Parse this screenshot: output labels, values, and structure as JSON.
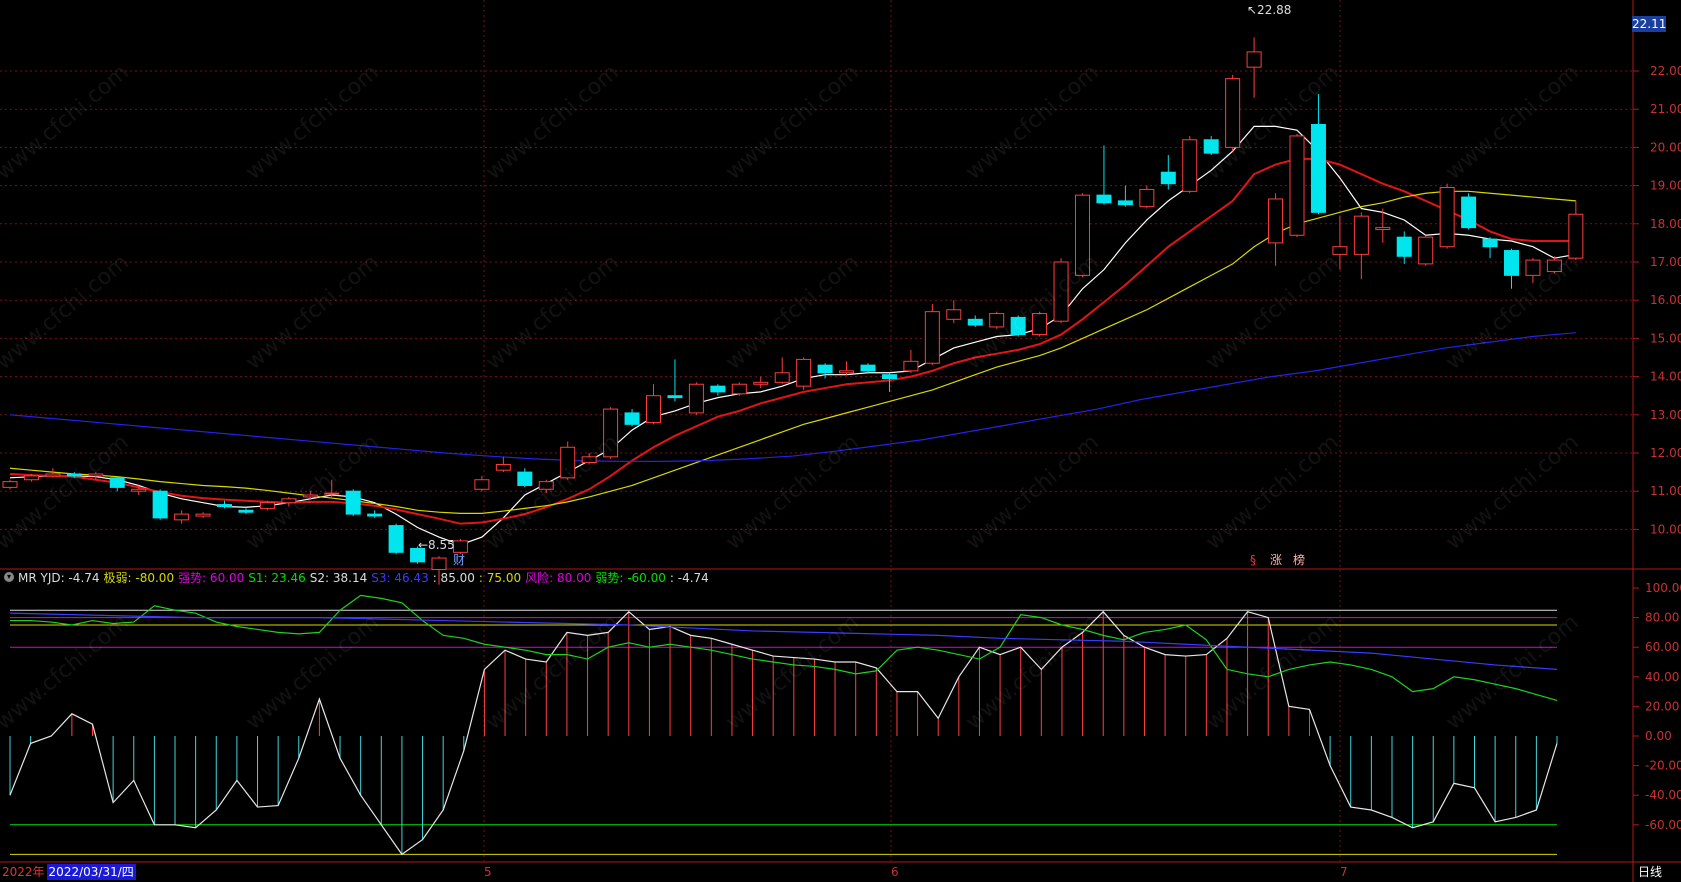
{
  "chart_data": [
    {
      "type": "candlestick",
      "title": "",
      "ylim": [
        9.0,
        22.9
      ],
      "y_ticks": [
        "22.00",
        "21.00",
        "20.00",
        "19.00",
        "18.00",
        "17.00",
        "16.00",
        "15.00",
        "14.00",
        "13.00",
        "12.00",
        "11.00",
        "10.00"
      ],
      "current_price": "22.11",
      "annotations": {
        "high": "22.88",
        "low": "8.55",
        "event_marker_1": "财",
        "event_marker_2": "§",
        "event_marker_3": "涨",
        "event_marker_4": "榜"
      },
      "x_month_labels": [
        "5",
        "6",
        "7"
      ],
      "candles": [
        {
          "o": 11.1,
          "c": 11.25,
          "h": 11.3,
          "l": 11.05
        },
        {
          "o": 11.3,
          "c": 11.4,
          "h": 11.45,
          "l": 11.25
        },
        {
          "o": 11.4,
          "c": 11.45,
          "h": 11.6,
          "l": 11.35
        },
        {
          "o": 11.45,
          "c": 11.4,
          "h": 11.5,
          "l": 11.35
        },
        {
          "o": 11.4,
          "c": 11.45,
          "h": 11.5,
          "l": 11.3
        },
        {
          "o": 11.35,
          "c": 11.1,
          "h": 11.4,
          "l": 11.0
        },
        {
          "o": 11.0,
          "c": 11.05,
          "h": 11.15,
          "l": 10.9
        },
        {
          "o": 11.0,
          "c": 10.3,
          "h": 11.05,
          "l": 10.25
        },
        {
          "o": 10.25,
          "c": 10.4,
          "h": 10.5,
          "l": 10.15
        },
        {
          "o": 10.35,
          "c": 10.4,
          "h": 10.45,
          "l": 10.3
        },
        {
          "o": 10.65,
          "c": 10.6,
          "h": 10.75,
          "l": 10.55
        },
        {
          "o": 10.5,
          "c": 10.45,
          "h": 10.55,
          "l": 10.4
        },
        {
          "o": 10.55,
          "c": 10.7,
          "h": 10.75,
          "l": 10.5
        },
        {
          "o": 10.7,
          "c": 10.8,
          "h": 10.85,
          "l": 10.6
        },
        {
          "o": 10.85,
          "c": 10.9,
          "h": 11.0,
          "l": 10.8
        },
        {
          "o": 10.95,
          "c": 10.95,
          "h": 11.3,
          "l": 10.85
        },
        {
          "o": 11.0,
          "c": 10.4,
          "h": 11.05,
          "l": 10.35
        },
        {
          "o": 10.4,
          "c": 10.35,
          "h": 10.5,
          "l": 10.3
        },
        {
          "o": 10.1,
          "c": 9.4,
          "h": 10.15,
          "l": 9.35
        },
        {
          "o": 9.5,
          "c": 9.15,
          "h": 9.55,
          "l": 9.1
        },
        {
          "o": 8.95,
          "c": 9.25,
          "h": 9.3,
          "l": 8.55
        },
        {
          "o": 9.4,
          "c": 9.7,
          "h": 9.75,
          "l": 9.35
        },
        {
          "o": 11.05,
          "c": 11.3,
          "h": 11.4,
          "l": 11.0
        },
        {
          "o": 11.55,
          "c": 11.7,
          "h": 11.9,
          "l": 11.5
        },
        {
          "o": 11.5,
          "c": 11.15,
          "h": 11.6,
          "l": 11.1
        },
        {
          "o": 11.05,
          "c": 11.25,
          "h": 11.3,
          "l": 10.95
        },
        {
          "o": 11.35,
          "c": 12.15,
          "h": 12.3,
          "l": 11.3
        },
        {
          "o": 11.75,
          "c": 11.9,
          "h": 12.0,
          "l": 11.7
        },
        {
          "o": 11.9,
          "c": 13.15,
          "h": 13.2,
          "l": 11.85
        },
        {
          "o": 13.05,
          "c": 12.75,
          "h": 13.15,
          "l": 12.7
        },
        {
          "o": 12.8,
          "c": 13.5,
          "h": 13.8,
          "l": 12.75
        },
        {
          "o": 13.5,
          "c": 13.45,
          "h": 14.45,
          "l": 13.35
        },
        {
          "o": 13.05,
          "c": 13.8,
          "h": 13.85,
          "l": 13.0
        },
        {
          "o": 13.75,
          "c": 13.6,
          "h": 13.8,
          "l": 13.5
        },
        {
          "o": 13.55,
          "c": 13.8,
          "h": 13.85,
          "l": 13.5
        },
        {
          "o": 13.8,
          "c": 13.85,
          "h": 14.0,
          "l": 13.7
        },
        {
          "o": 13.85,
          "c": 14.1,
          "h": 14.5,
          "l": 13.8
        },
        {
          "o": 13.75,
          "c": 14.45,
          "h": 14.5,
          "l": 13.65
        },
        {
          "o": 14.3,
          "c": 14.1,
          "h": 14.35,
          "l": 13.95
        },
        {
          "o": 14.1,
          "c": 14.15,
          "h": 14.4,
          "l": 14.05
        },
        {
          "o": 14.3,
          "c": 14.15,
          "h": 14.35,
          "l": 14.1
        },
        {
          "o": 14.05,
          "c": 13.95,
          "h": 14.1,
          "l": 13.6
        },
        {
          "o": 14.15,
          "c": 14.4,
          "h": 14.7,
          "l": 14.1
        },
        {
          "o": 14.35,
          "c": 15.7,
          "h": 15.9,
          "l": 14.3
        },
        {
          "o": 15.5,
          "c": 15.75,
          "h": 16.0,
          "l": 15.4
        },
        {
          "o": 15.5,
          "c": 15.35,
          "h": 15.6,
          "l": 15.3
        },
        {
          "o": 15.3,
          "c": 15.65,
          "h": 15.7,
          "l": 15.25
        },
        {
          "o": 15.55,
          "c": 15.1,
          "h": 15.6,
          "l": 15.05
        },
        {
          "o": 15.1,
          "c": 15.65,
          "h": 15.7,
          "l": 15.05
        },
        {
          "o": 15.45,
          "c": 17.0,
          "h": 17.1,
          "l": 15.4
        },
        {
          "o": 16.65,
          "c": 18.75,
          "h": 18.8,
          "l": 16.6
        },
        {
          "o": 18.75,
          "c": 18.55,
          "h": 20.05,
          "l": 18.5
        },
        {
          "o": 18.6,
          "c": 18.5,
          "h": 19.0,
          "l": 18.45
        },
        {
          "o": 18.45,
          "c": 18.9,
          "h": 19.0,
          "l": 18.4
        },
        {
          "o": 19.35,
          "c": 19.05,
          "h": 19.8,
          "l": 18.9
        },
        {
          "o": 18.85,
          "c": 20.2,
          "h": 20.3,
          "l": 18.8
        },
        {
          "o": 20.2,
          "c": 19.85,
          "h": 20.3,
          "l": 19.8
        },
        {
          "o": 20.0,
          "c": 21.8,
          "h": 21.9,
          "l": 19.9
        },
        {
          "o": 22.1,
          "c": 22.5,
          "h": 22.88,
          "l": 21.3
        },
        {
          "o": 17.5,
          "c": 18.65,
          "h": 18.8,
          "l": 16.9
        },
        {
          "o": 17.7,
          "c": 20.3,
          "h": 20.35,
          "l": 17.65
        },
        {
          "o": 20.6,
          "c": 18.3,
          "h": 21.4,
          "l": 18.25
        },
        {
          "o": 17.2,
          "c": 17.4,
          "h": 18.2,
          "l": 16.8
        },
        {
          "o": 17.2,
          "c": 18.2,
          "h": 18.3,
          "l": 16.55
        },
        {
          "o": 17.85,
          "c": 17.9,
          "h": 18.4,
          "l": 17.5
        },
        {
          "o": 17.65,
          "c": 17.15,
          "h": 17.8,
          "l": 16.95
        },
        {
          "o": 16.95,
          "c": 17.65,
          "h": 17.7,
          "l": 16.9
        },
        {
          "o": 17.4,
          "c": 18.95,
          "h": 19.05,
          "l": 17.35
        },
        {
          "o": 18.7,
          "c": 17.9,
          "h": 18.8,
          "l": 17.85
        },
        {
          "o": 17.6,
          "c": 17.4,
          "h": 17.65,
          "l": 17.1
        },
        {
          "o": 17.3,
          "c": 16.65,
          "h": 17.35,
          "l": 16.3
        },
        {
          "o": 16.65,
          "c": 17.05,
          "h": 17.1,
          "l": 16.45
        },
        {
          "o": 16.75,
          "c": 17.05,
          "h": 17.15,
          "l": 16.7
        },
        {
          "o": 17.1,
          "c": 18.25,
          "h": 18.6,
          "l": 17.05
        }
      ],
      "series": [
        {
          "color": "#ffffff",
          "values": [
            11.35,
            11.38,
            11.4,
            11.4,
            11.38,
            11.3,
            11.15,
            10.95,
            10.8,
            10.7,
            10.6,
            10.58,
            10.62,
            10.7,
            10.8,
            10.9,
            10.85,
            10.7,
            10.4,
            10.05,
            9.8,
            9.6,
            9.8,
            10.3,
            10.9,
            11.2,
            11.5,
            11.8,
            12.1,
            12.6,
            12.95,
            13.1,
            13.3,
            13.45,
            13.55,
            13.6,
            13.75,
            13.95,
            14.05,
            14.05,
            14.1,
            14.1,
            14.15,
            14.45,
            14.75,
            14.9,
            15.05,
            15.1,
            15.25,
            15.6,
            16.3,
            16.8,
            17.5,
            18.1,
            18.6,
            19.0,
            19.4,
            19.9,
            20.55,
            20.55,
            20.45,
            19.9,
            19.2,
            18.4,
            18.3,
            18.1,
            17.7,
            17.75,
            17.7,
            17.6,
            17.55,
            17.4,
            17.1,
            17.2
          ]
        },
        {
          "color": "#e41414",
          "values": [
            11.45,
            11.42,
            11.4,
            11.38,
            11.3,
            11.22,
            11.1,
            10.98,
            10.88,
            10.82,
            10.78,
            10.75,
            10.72,
            10.7,
            10.72,
            10.72,
            10.68,
            10.62,
            10.52,
            10.4,
            10.28,
            10.15,
            10.18,
            10.28,
            10.4,
            10.58,
            10.8,
            11.05,
            11.4,
            11.8,
            12.15,
            12.45,
            12.7,
            12.95,
            13.1,
            13.3,
            13.45,
            13.6,
            13.7,
            13.8,
            13.85,
            13.9,
            14.0,
            14.15,
            14.35,
            14.5,
            14.6,
            14.7,
            14.85,
            15.1,
            15.5,
            15.95,
            16.4,
            16.9,
            17.4,
            17.8,
            18.2,
            18.6,
            19.3,
            19.55,
            19.7,
            19.7,
            19.55,
            19.3,
            19.05,
            18.85,
            18.6,
            18.35,
            18.1,
            17.8,
            17.6,
            17.55,
            17.55,
            17.55
          ]
        },
        {
          "color": "#d8d800",
          "values": [
            11.6,
            11.55,
            11.5,
            11.45,
            11.42,
            11.38,
            11.32,
            11.25,
            11.2,
            11.15,
            11.12,
            11.08,
            11.02,
            10.95,
            10.88,
            10.82,
            10.75,
            10.68,
            10.6,
            10.5,
            10.45,
            10.42,
            10.42,
            10.48,
            10.55,
            10.62,
            10.72,
            10.85,
            11.0,
            11.15,
            11.35,
            11.55,
            11.75,
            11.95,
            12.15,
            12.35,
            12.55,
            12.75,
            12.9,
            13.05,
            13.2,
            13.35,
            13.5,
            13.65,
            13.85,
            14.05,
            14.25,
            14.4,
            14.55,
            14.75,
            15.0,
            15.25,
            15.5,
            15.75,
            16.05,
            16.35,
            16.65,
            16.95,
            17.4,
            17.75,
            18.0,
            18.15,
            18.3,
            18.45,
            18.55,
            18.7,
            18.8,
            18.85,
            18.85,
            18.8,
            18.75,
            18.7,
            18.65,
            18.6
          ]
        },
        {
          "color": "#2323e6",
          "values": [
            13.0,
            12.9,
            12.8,
            12.7,
            12.6,
            12.5,
            12.4,
            12.3,
            12.2,
            12.1,
            12.0,
            11.92,
            11.85,
            11.8,
            11.78,
            11.78,
            11.8,
            11.85,
            11.92,
            12.05,
            12.2,
            12.35,
            12.55,
            12.75,
            12.95,
            13.15,
            13.4,
            13.6,
            13.8,
            14.0,
            14.15,
            14.35,
            14.55,
            14.75,
            14.9,
            15.05,
            15.15
          ]
        }
      ]
    },
    {
      "type": "indicator",
      "name": "MR YJD",
      "ylim": [
        -80,
        100
      ],
      "y_ticks": [
        "100.00",
        "80.00",
        "60.00",
        "40.00",
        "20.00",
        "0.00",
        "-20.00",
        "-40.00",
        "-60.00"
      ],
      "legend": [
        {
          "text": "MR YJD: -4.74",
          "color": "#dcdcdc"
        },
        {
          "text": "极弱: -80.00",
          "color": "#d8d800"
        },
        {
          "text": "强势: 60.00",
          "color": "#e000e0"
        },
        {
          "text": "S1: 23.46",
          "color": "#00e000"
        },
        {
          "text": "S2: 38.14",
          "color": "#dcdcdc"
        },
        {
          "text": "S3: 46.43",
          "color": "#3b3bff"
        },
        {
          "text": ": 85.00",
          "color": "#dcdcdc"
        },
        {
          "text": ": 75.00",
          "color": "#d8d800"
        },
        {
          "text": "风险: 80.00",
          "color": "#e000e0"
        },
        {
          "text": "弱势: -60.00",
          "color": "#00e000"
        },
        {
          "text": ": -4.74",
          "color": "#dcdcdc"
        }
      ],
      "levels": [
        {
          "value": 85,
          "color": "#dcdcdc"
        },
        {
          "value": 80,
          "color": "#e000e0"
        },
        {
          "value": 75,
          "color": "#d8d800"
        },
        {
          "value": 60,
          "color": "#e000e0"
        },
        {
          "value": -60,
          "color": "#00e000"
        },
        {
          "value": -80,
          "color": "#d8d800"
        }
      ],
      "mr_values": [
        -40,
        -5,
        0,
        15,
        8,
        -45,
        -30,
        -60,
        -60,
        -62,
        -50,
        -30,
        -48,
        -47,
        -15,
        25,
        -15,
        -40,
        -60,
        -80,
        -70,
        -50,
        -10,
        45,
        58,
        52,
        50,
        70,
        68,
        70,
        84,
        72,
        74,
        68,
        66,
        62,
        58,
        54,
        53,
        52,
        50,
        50,
        46,
        30,
        30,
        12,
        40,
        60,
        55,
        60,
        45,
        60,
        70,
        84,
        68,
        60,
        55,
        54,
        55,
        66,
        84,
        80,
        20,
        18,
        -20,
        -48,
        -50,
        -55,
        -62,
        -58,
        -32,
        -35,
        -58,
        -55,
        -50,
        -5
      ],
      "s1_values": [
        78,
        78,
        77,
        75,
        78,
        76,
        77,
        88,
        85,
        83,
        77,
        74,
        72,
        70,
        69,
        70,
        85,
        95,
        93,
        90,
        78,
        68,
        66,
        62,
        60,
        58,
        55,
        55,
        52,
        60,
        63,
        60,
        62,
        60,
        58,
        55,
        52,
        50,
        48,
        47,
        45,
        42,
        44,
        58,
        60,
        58,
        55,
        52,
        60,
        82,
        80,
        75,
        72,
        68,
        65,
        70,
        72,
        75,
        65,
        45,
        42,
        40,
        45,
        48,
        50,
        48,
        45,
        40,
        30,
        32,
        40,
        38,
        35,
        32,
        28,
        24
      ]
    }
  ],
  "ui": {
    "date_year": "2022年",
    "date_selected": "2022/03/31/四",
    "period": "日线"
  }
}
